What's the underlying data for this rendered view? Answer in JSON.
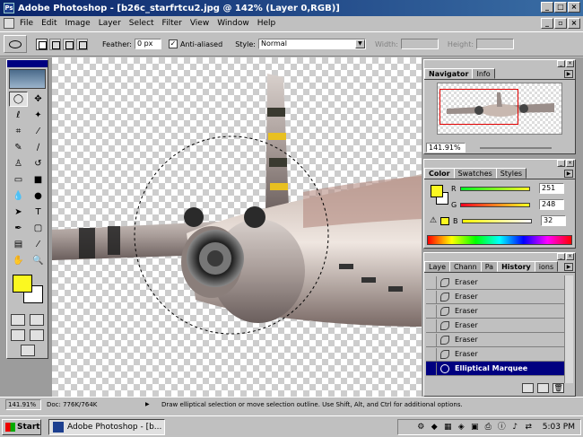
{
  "window": {
    "title": "Adobe Photoshop - [b26c_starfrtcu2.jpg @ 142% (Layer 0,RGB)]"
  },
  "menu": [
    "File",
    "Edit",
    "Image",
    "Layer",
    "Select",
    "Filter",
    "View",
    "Window",
    "Help"
  ],
  "options": {
    "feather_label": "Feather:",
    "feather_value": "0 px",
    "antialiased_label": "Anti-aliased",
    "antialiased_checked": "✓",
    "style_label": "Style:",
    "style_value": "Normal",
    "width_label": "Width:",
    "height_label": "Height:"
  },
  "navigator": {
    "tabs": [
      "Navigator",
      "Info"
    ],
    "zoom": "141.91%"
  },
  "color": {
    "tabs": [
      "Color",
      "Swatches",
      "Styles"
    ],
    "r_label": "R",
    "r_value": "251",
    "g_label": "G",
    "g_value": "248",
    "b_label": "B",
    "b_value": "32",
    "fg_hex": "#fbf820"
  },
  "history": {
    "tabs": [
      "Laye",
      "Chann",
      "Pa",
      "History",
      "ions"
    ],
    "items": [
      {
        "label": "Eraser"
      },
      {
        "label": "Eraser"
      },
      {
        "label": "Eraser"
      },
      {
        "label": "Eraser"
      },
      {
        "label": "Eraser"
      },
      {
        "label": "Eraser"
      },
      {
        "label": "Elliptical Marquee"
      }
    ]
  },
  "status": {
    "zoom": "141.91%",
    "doc": "Doc: 776K/764K",
    "hint": "Draw elliptical selection or move selection outline.  Use Shift, Alt, and Ctrl for additional options."
  },
  "taskbar": {
    "start": "Start",
    "task": "Adobe Photoshop - [b...",
    "clock": "5:03 PM"
  }
}
